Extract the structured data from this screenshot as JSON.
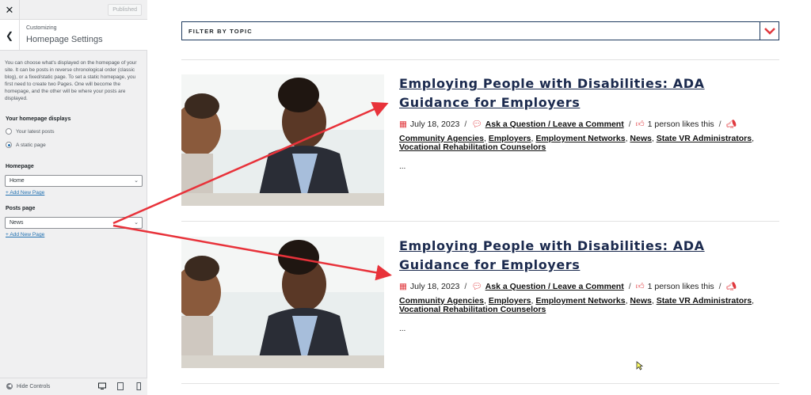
{
  "customizer": {
    "close_icon": "close-icon",
    "published_label": "Published",
    "section_sub": "Customizing",
    "section_title": "Homepage Settings",
    "description": "You can choose what's displayed on the homepage of your site. It can be posts in reverse chronological order (classic blog), or a fixed/static page. To set a static homepage, you first need to create two Pages. One will become the homepage, and the other will be where your posts are displayed.",
    "displays_label": "Your homepage displays",
    "radio_latest": "Your latest posts",
    "radio_static": "A static page",
    "selected_radio": "A static page",
    "homepage_label": "Homepage",
    "homepage_value": "Home",
    "add_new_page_1": "+ Add New Page",
    "posts_page_label": "Posts page",
    "posts_page_value": "News",
    "add_new_page_2": "+ Add New Page",
    "hide_controls": "Hide Controls",
    "devices": [
      "desktop-icon",
      "tablet-icon",
      "mobile-icon"
    ]
  },
  "preview": {
    "filter_label": "FILTER BY TOPIC",
    "accent_color": "#e0393e",
    "title_color": "#1b2a4e",
    "posts": [
      {
        "title": "Employing People with Disabilities: ADA Guidance for Employers",
        "date": "July 18, 2023",
        "comment_link": "Ask a Question / Leave a Comment",
        "likes": "1 person likes this",
        "categories": [
          "Community Agencies",
          "Employers",
          "Employment Networks",
          "News",
          "State VR Administrators",
          "Vocational Rehabilitation Counselors"
        ],
        "excerpt": "..."
      },
      {
        "title": "Employing People with Disabilities: ADA Guidance for Employers",
        "date": "July 18, 2023",
        "comment_link": "Ask a Question / Leave a Comment",
        "likes": "1 person likes this",
        "categories": [
          "Community Agencies",
          "Employers",
          "Employment Networks",
          "News",
          "State VR Administrators",
          "Vocational Rehabilitation Counselors"
        ],
        "excerpt": "..."
      }
    ]
  }
}
